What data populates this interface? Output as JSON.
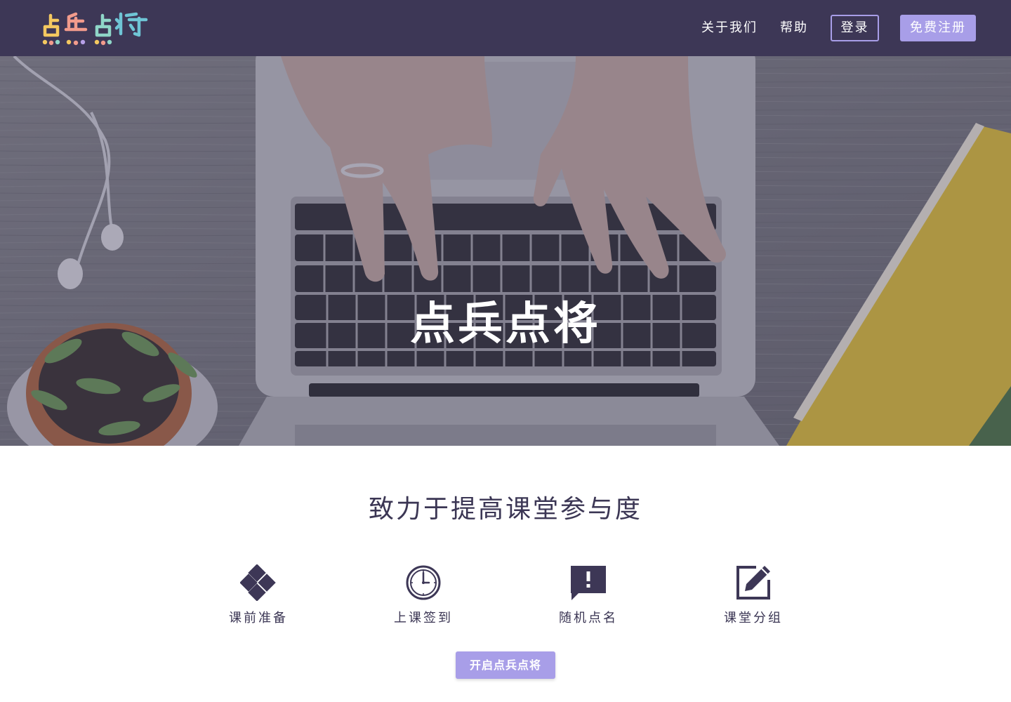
{
  "brand": {
    "logo_text": "点兵点将"
  },
  "nav": {
    "about_label": "关于我们",
    "help_label": "帮助",
    "login_label": "登录",
    "register_label": "免费注册"
  },
  "hero": {
    "title": "点兵点将"
  },
  "main": {
    "subtitle": "致力于提高课堂参与度",
    "features": [
      {
        "label": "课前准备",
        "icon": "diamond-grid-icon"
      },
      {
        "label": "上课签到",
        "icon": "clock-icon"
      },
      {
        "label": "随机点名",
        "icon": "exclamation-comment-icon"
      },
      {
        "label": "课堂分组",
        "icon": "edit-icon"
      }
    ],
    "cta_label": "开启点兵点将"
  },
  "colors": {
    "nav_bg": "#3d3756",
    "accent": "#a89ee8",
    "text": "#3b3654"
  }
}
